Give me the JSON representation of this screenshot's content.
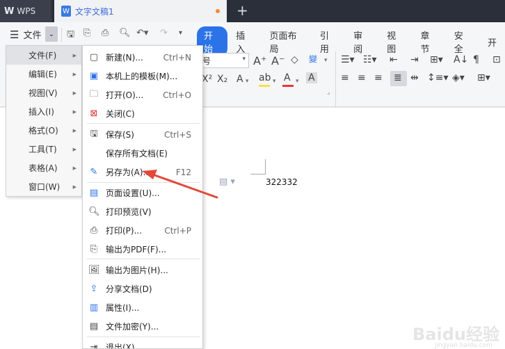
{
  "titlebar": {
    "wps_label": "WPS",
    "doc_tab_label": "文字文稿1",
    "new_tab": "+"
  },
  "ribbon": {
    "file_label": "文件",
    "tabs": [
      "开始",
      "插入",
      "页面布局",
      "引用",
      "审阅",
      "视图",
      "章节",
      "安全",
      "开"
    ],
    "font_size_value": "号"
  },
  "main_menu": {
    "items": [
      {
        "label": "文件(F)"
      },
      {
        "label": "编辑(E)"
      },
      {
        "label": "视图(V)"
      },
      {
        "label": "插入(I)"
      },
      {
        "label": "格式(O)"
      },
      {
        "label": "工具(T)"
      },
      {
        "label": "表格(A)"
      },
      {
        "label": "窗口(W)"
      }
    ]
  },
  "file_menu": {
    "items": [
      {
        "label": "新建(N)...",
        "shortcut": "Ctrl+N",
        "icon": "new-doc-icon"
      },
      {
        "label": "本机上的模板(M)...",
        "shortcut": "",
        "icon": "template-icon"
      },
      {
        "label": "打开(O)...",
        "shortcut": "Ctrl+O",
        "icon": "open-folder-icon"
      },
      {
        "label": "关闭(C)",
        "shortcut": "",
        "icon": "close-doc-icon"
      },
      {
        "label": "保存(S)",
        "shortcut": "Ctrl+S",
        "icon": "save-icon"
      },
      {
        "label": "保存所有文档(E)",
        "shortcut": "",
        "icon": ""
      },
      {
        "label": "另存为(A)...",
        "shortcut": "F12",
        "icon": "save-as-icon"
      },
      {
        "label": "页面设置(U)...",
        "shortcut": "",
        "icon": "page-setup-icon"
      },
      {
        "label": "打印预览(V)",
        "shortcut": "",
        "icon": "print-preview-icon"
      },
      {
        "label": "打印(P)...",
        "shortcut": "Ctrl+P",
        "icon": "print-icon"
      },
      {
        "label": "输出为PDF(F)...",
        "shortcut": "",
        "icon": "pdf-icon"
      },
      {
        "label": "输出为图片(H)...",
        "shortcut": "",
        "icon": "export-image-icon"
      },
      {
        "label": "分享文档(D)",
        "shortcut": "",
        "icon": "share-icon"
      },
      {
        "label": "属性(I)...",
        "shortcut": "",
        "icon": "properties-icon"
      },
      {
        "label": "文件加密(Y)...",
        "shortcut": "",
        "icon": "encrypt-icon"
      },
      {
        "label": "退出(X)",
        "shortcut": "",
        "icon": "exit-icon"
      }
    ]
  },
  "document": {
    "text": "322332"
  },
  "watermark": {
    "brand": "Baidu经验",
    "sub": "jingyan.baidu.com"
  }
}
